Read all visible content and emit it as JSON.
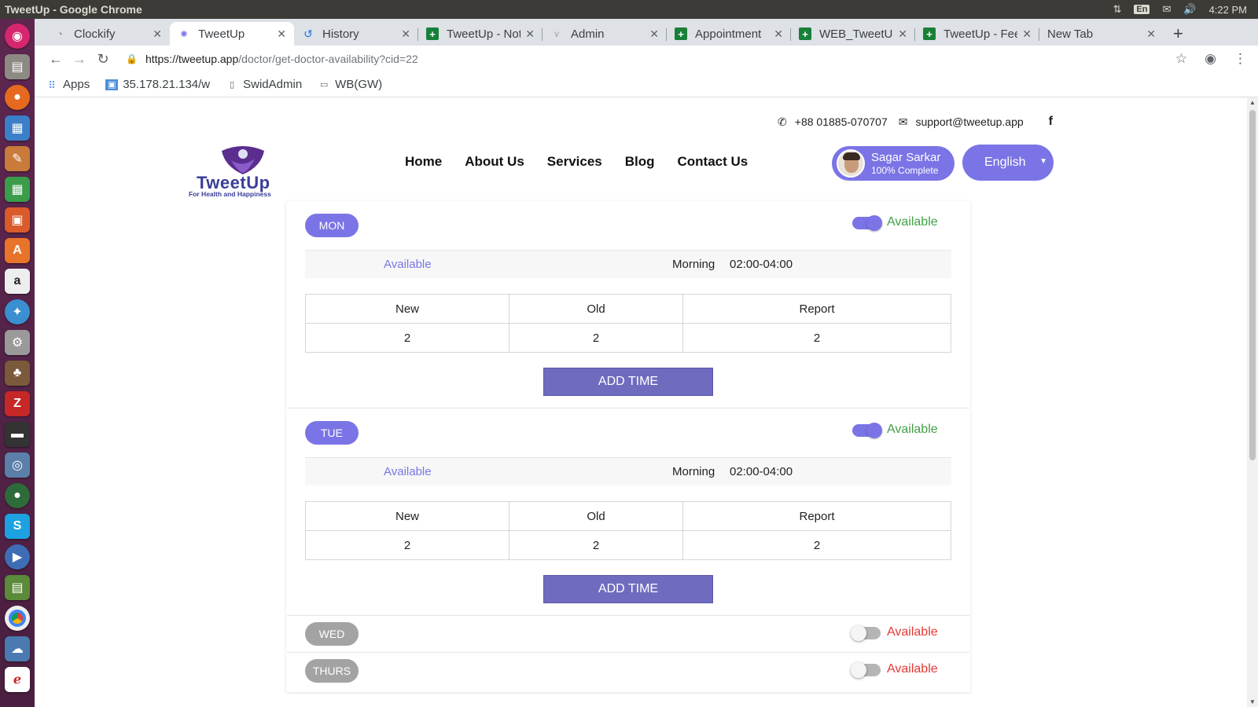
{
  "os": {
    "window_title": "TweetUp - Google Chrome",
    "lang": "En",
    "clock": "4:22 PM"
  },
  "tabs": [
    {
      "label": "Clockify",
      "icon": "clockify-icon"
    },
    {
      "label": "TweetUp",
      "icon": "tweetup-icon",
      "active": true
    },
    {
      "label": "History",
      "icon": "history-icon"
    },
    {
      "label": "TweetUp - Not",
      "icon": "sheets-icon"
    },
    {
      "label": "Admin",
      "icon": "admin-icon"
    },
    {
      "label": "Appointment",
      "icon": "sheets-icon"
    },
    {
      "label": "WEB_TweetUp",
      "icon": "sheets-icon"
    },
    {
      "label": "TweetUp - Fee",
      "icon": "sheets-icon"
    },
    {
      "label": "New Tab",
      "icon": "none"
    }
  ],
  "address": {
    "host": "https://tweetup.app",
    "path": "/doctor/get-doctor-availability?cid=22"
  },
  "bookmarks": [
    {
      "label": "Apps"
    },
    {
      "label": "35.178.21.134/w"
    },
    {
      "label": "SwidAdmin"
    },
    {
      "label": "WB(GW)"
    }
  ],
  "site": {
    "phone": "+88 01885-070707",
    "email": "support@tweetup.app",
    "logo_text": "TweetUp",
    "logo_tagline": "For Health and Happiness",
    "nav": [
      "Home",
      "About Us",
      "Services",
      "Blog",
      "Contact Us"
    ],
    "user_name": "Sagar Sarkar",
    "user_status": "100% Complete",
    "language": "English",
    "accent_color": "#7b74e6"
  },
  "days": [
    {
      "day": "MON",
      "enabled": true,
      "availability_label": "Available",
      "slot": {
        "status": "Available",
        "period": "Morning",
        "time": "02:00-04:00"
      },
      "headers": [
        "New",
        "Old",
        "Report"
      ],
      "values": [
        "2",
        "2",
        "2"
      ],
      "button": "ADD TIME"
    },
    {
      "day": "TUE",
      "enabled": true,
      "availability_label": "Available",
      "slot": {
        "status": "Available",
        "period": "Morning",
        "time": "02:00-04:00"
      },
      "headers": [
        "New",
        "Old",
        "Report"
      ],
      "values": [
        "2",
        "2",
        "2"
      ],
      "button": "ADD TIME"
    },
    {
      "day": "WED",
      "enabled": false,
      "availability_label": "Available"
    },
    {
      "day": "THURS",
      "enabled": false,
      "availability_label": "Available"
    }
  ]
}
